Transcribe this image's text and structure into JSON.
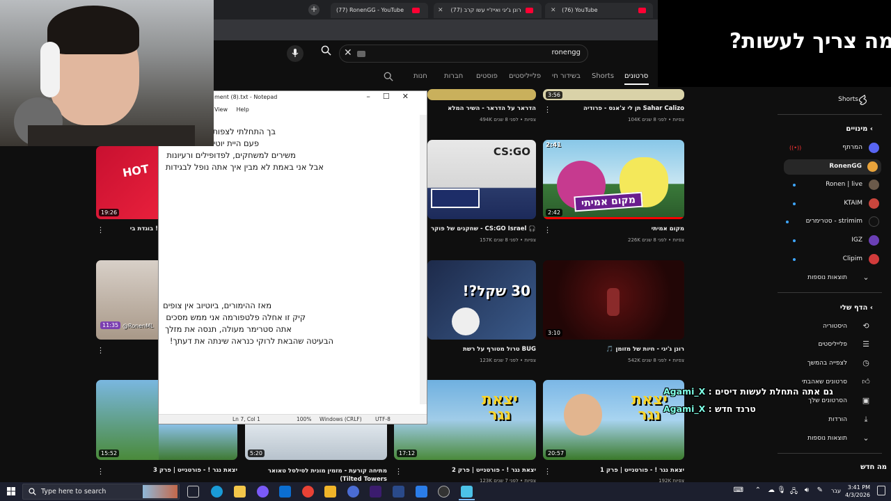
{
  "browser": {
    "tabs": [
      {
        "title": "(77) RonenGG - YouTube"
      },
      {
        "title": "רונן ג'יגי ואייז'יי עשו קרב (77)"
      },
      {
        "title": "(76) YouTube"
      }
    ]
  },
  "youtube": {
    "search_query": "ronengg",
    "channel_tabs": [
      "סרטונים",
      "Shorts",
      "בשידור חי",
      "פלייליסטים",
      "פוסטים",
      "חברות",
      "חנות"
    ],
    "sidebar": {
      "shorts_label": "Shorts",
      "subscriptions_header": "מינויים",
      "subscriptions": [
        {
          "name": "המרתף",
          "color": "#5865f2",
          "live": true
        },
        {
          "name": "RonenGG",
          "color": "#e8a33b",
          "active": true
        },
        {
          "name": "Ronen | live",
          "color": "#6b5a4a"
        },
        {
          "name": "KTAIM",
          "color": "#c9463d"
        },
        {
          "name": "סטרימרים - strimim",
          "color": "#111111"
        },
        {
          "name": "IGZ",
          "color": "#6a3fb5"
        },
        {
          "name": "Clipim",
          "color": "#d13b3b"
        }
      ],
      "more_results": "תוצאות נוספות",
      "you_header": "הדף שלי",
      "you_items": [
        {
          "label": "היסטוריה",
          "icon": "history-icon"
        },
        {
          "label": "פלייליסטים",
          "icon": "playlist-icon"
        },
        {
          "label": "לצפייה בהמשך",
          "icon": "clock-icon"
        },
        {
          "label": "סרטונים שאהבתי",
          "icon": "thumbs-up-icon"
        },
        {
          "label": "הסרטונים שלך",
          "icon": "video-icon"
        },
        {
          "label": "הורדות",
          "icon": "download-icon"
        }
      ],
      "more_results_2": "תוצאות נוספות",
      "whats_new": "מה חדש"
    },
    "videos_row0": [
      {
        "title": "תן לי צ'אנס - פרודיה Sahar Calizo",
        "meta": "104K צפיות • לפני 8 שנים",
        "duration": "3:56"
      },
      {
        "title": "הדראר על הדראר - השיר המלא",
        "meta": "494K צפיות • לפני 8 שנים"
      }
    ],
    "videos_row1": [
      {
        "title": "מקום אמיתי",
        "meta": "226K צפיות • לפני 8 שנים",
        "duration": "2:42",
        "badge": "2:41",
        "thumb_text": "מקום אמיתי"
      },
      {
        "title": "שחקנים של פוקר - CS:GO Israel 🎧",
        "meta": "157K צפיות • לפני 8 שנים",
        "thumb_text": "CS:GO"
      },
      {
        "title": "בוגדת בי !",
        "duration": "19:26",
        "thumb_text": "HOT"
      }
    ],
    "videos_row2": [
      {
        "title": "🎵 רונן ג'יגי - חיות של מזומן",
        "meta": "542K צפיות • לפני 8 שנים",
        "duration": "3:10"
      },
      {
        "title": "טרול מטורף על רשת BUG",
        "meta": "123K צפיות • לפני 7 שנים",
        "thumb_text": "30 שקל?!"
      },
      {
        "duration": "11:35",
        "thumb_text": "@RonenML"
      }
    ],
    "videos_row3": [
      {
        "title": "יצאת נגר ! - פורטנייט | פרק 1",
        "meta": "192K צפיות",
        "duration": "20:57",
        "thumb_text": "יצאת נגר"
      },
      {
        "title": "יצאת נגר ! - פורטנייט | פרק 2",
        "meta": "123K צפיות • לפני 7 שנים",
        "duration": "17:12",
        "thumb_text": "יצאת נגר"
      },
      {
        "title": "מתיחה קורעת - מזמין מונית לסילסל טאואר (Tilted Towers",
        "duration": "5:20"
      },
      {
        "title": "יצאת נגר ! - פורטנייט | פרק 3",
        "duration": "15:52"
      }
    ]
  },
  "notepad": {
    "title": "ment (8).txt - Notepad",
    "menu": [
      "View",
      "Help"
    ],
    "lines_top": [
      "בך התחלתי לצפות",
      "פעם היית יוטיובר",
      "משירים למשחקים, לפדופילים ורעיונות",
      "אבל אני באמת לא מבין איך אתה נופל לבגידות"
    ],
    "lines_bottom": [
      "מאז ההימורים, ביוטיוב אין צופים",
      "קיק זו אחלה פלטפורמה אני ממש מסכים",
      "אתה סטרימר מעולה, תנסה את מזלך",
      "הבעיטה שהבאת לרוקי כנראה שינתה את דעתך!"
    ],
    "status": {
      "position": "Ln 7, Col 1",
      "zoom": "100%",
      "eol": "Windows (CRLF)",
      "encoding": "UTF-8"
    }
  },
  "overlay": {
    "question": "מה צריך לעשות?",
    "chat": [
      {
        "user": "Agami_X",
        "message": "גם אתה התחלת לעשות דיסים"
      },
      {
        "user": "Agami_X",
        "message": "טרנד חדש"
      }
    ]
  },
  "taskbar": {
    "search_placeholder": "Type here to search",
    "language": "עבר",
    "time": "3:41 PM",
    "date": "4/3/2026"
  }
}
